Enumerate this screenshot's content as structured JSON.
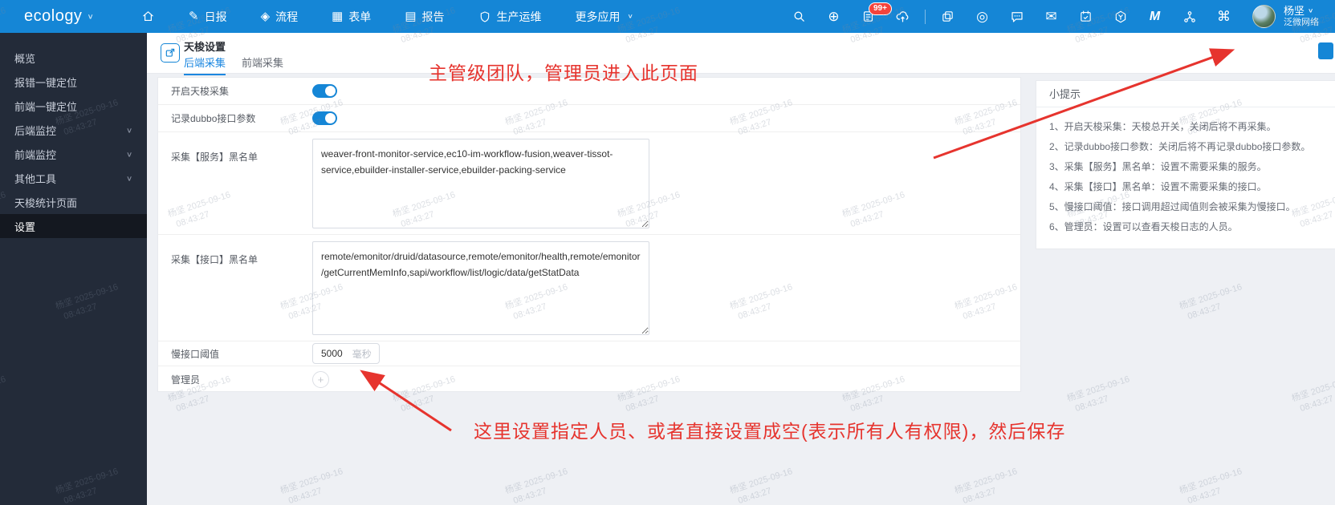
{
  "navbar": {
    "logo": "ecology",
    "items": [
      {
        "label": "日报"
      },
      {
        "label": "流程"
      },
      {
        "label": "表单"
      },
      {
        "label": "报告"
      },
      {
        "label": "生产运维"
      },
      {
        "label": "更多应用"
      }
    ],
    "todo_badge": "99+",
    "user": {
      "name": "杨坚",
      "org": "泛微网络"
    }
  },
  "icons": {
    "edit": "✎",
    "workflow": "◈",
    "form": "▦",
    "report": "▤",
    "plus": "⊕",
    "record": "◎",
    "mail": "✉",
    "command": "⌘",
    "chevron_down": "∨",
    "m_app": "M",
    "admin_add": "+"
  },
  "sidebar": {
    "items": [
      {
        "label": "概览",
        "expandable": false,
        "active": false
      },
      {
        "label": "报错一键定位",
        "expandable": false,
        "active": false
      },
      {
        "label": "前端一键定位",
        "expandable": false,
        "active": false
      },
      {
        "label": "后端监控",
        "expandable": true,
        "active": false
      },
      {
        "label": "前端监控",
        "expandable": true,
        "active": false
      },
      {
        "label": "其他工具",
        "expandable": true,
        "active": false
      },
      {
        "label": "天梭统计页面",
        "expandable": false,
        "active": false
      },
      {
        "label": "设置",
        "expandable": false,
        "active": true
      }
    ]
  },
  "page": {
    "title": "天梭设置",
    "tabs": [
      {
        "label": "后端采集",
        "active": true
      },
      {
        "label": "前端采集",
        "active": false
      }
    ]
  },
  "form": {
    "fields": [
      {
        "label": "开启天梭采集",
        "type": "switch",
        "value": true
      },
      {
        "label": "记录dubbo接口参数",
        "type": "switch",
        "value": true
      },
      {
        "label": "采集【服务】黑名单",
        "type": "textarea",
        "value": "weaver-front-monitor-service,ec10-im-workflow-fusion,weaver-tissot-service,ebuilder-installer-service,ebuilder-packing-service"
      },
      {
        "label": "采集【接口】黑名单",
        "type": "textarea",
        "value": "remote/emonitor/druid/datasource,remote/emonitor/health,remote/emonitor/getCurrentMemInfo,sapi/workflow/list/logic/data/getStatData"
      },
      {
        "label": "慢接口阈值",
        "type": "number",
        "value": "5000",
        "unit": "毫秒"
      },
      {
        "label": "管理员",
        "type": "member-picker",
        "value": ""
      }
    ]
  },
  "tips": {
    "title": "小提示",
    "items": [
      "1、开启天梭采集：天梭总开关，关闭后将不再采集。",
      "2、记录dubbo接口参数：关闭后将不再记录dubbo接口参数。",
      "3、采集【服务】黑名单：设置不需要采集的服务。",
      "4、采集【接口】黑名单：设置不需要采集的接口。",
      "5、慢接口阈值：接口调用超过阈值则会被采集为慢接口。",
      "6、管理员：设置可以查看天梭日志的人员。"
    ]
  },
  "annotations": {
    "top": "主管级团队，管理员进入此页面",
    "bottom": "这里设置指定人员、或者直接设置成空(表示所有人有权限)，然后保存",
    "color": "#e6342e"
  },
  "watermark": {
    "name": "杨坚",
    "date": "2025-09-16",
    "time": "08:43:27"
  },
  "colors": {
    "navbar": "#1586d6",
    "sidebar": "#232b39",
    "accent": "#1c87e0",
    "badge": "#f4433c"
  }
}
